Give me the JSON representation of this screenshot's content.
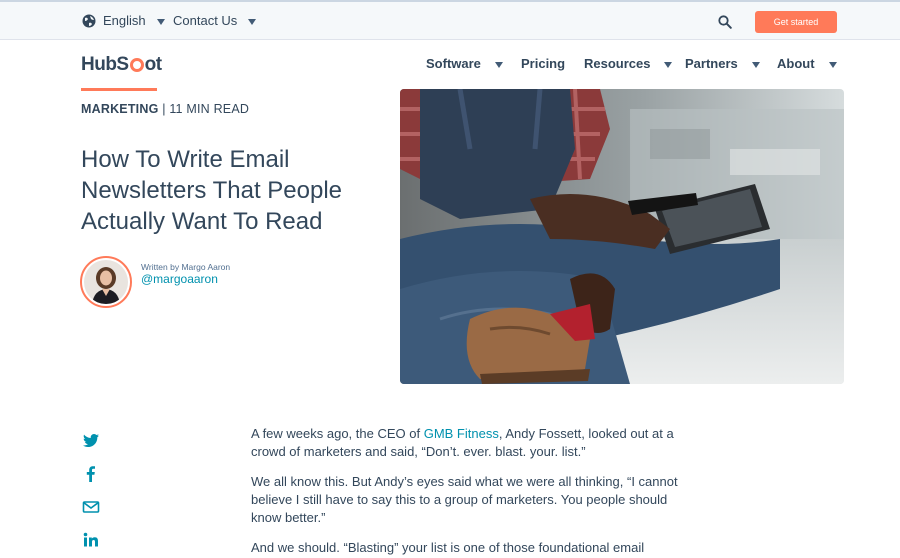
{
  "utility_bar": {
    "language_label": "English",
    "contact_label": "Contact Us",
    "cta_label": "Get started",
    "accent_color": "#ff7a59"
  },
  "nav": {
    "logo_text_start": "HubS",
    "logo_text_end": "ot",
    "items": [
      {
        "label": "Software",
        "has_dropdown": true
      },
      {
        "label": "Pricing",
        "has_dropdown": false
      },
      {
        "label": "Resources",
        "has_dropdown": true
      },
      {
        "label": "Partners",
        "has_dropdown": true
      },
      {
        "label": "About",
        "has_dropdown": true
      }
    ]
  },
  "article": {
    "topic": "MARKETING",
    "separator": "|",
    "read_time": "11 MIN READ",
    "title": "How To Write Email Newsletters That People Actually Want To Read",
    "author_byline": "Written by Margo Aaron",
    "author_handle": "@margoaaron",
    "link_color": "#0091ae"
  },
  "social_icons": [
    "twitter-icon",
    "facebook-icon",
    "email-icon",
    "linkedin-icon"
  ],
  "body": {
    "p1_before": "A few weeks ago, the CEO of ",
    "p1_link": "GMB Fitness",
    "p1_after": ", Andy Fossett, looked out at a crowd of marketers and said, “Don’t. ever. blast. your. list.”",
    "p2": "We all know this. But Andy’s eyes said what we were all thinking, “I cannot believe I still have to say this to a group of marketers. You people should know better.”",
    "p3": "And we should. “Blasting” your list is one of those foundational email"
  }
}
